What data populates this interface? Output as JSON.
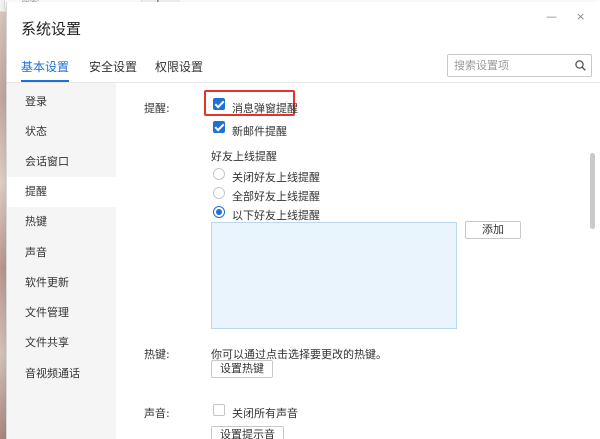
{
  "background": {
    "search_placeholder": "搜索",
    "add_symbol": "+"
  },
  "dialog": {
    "title": "系统设置",
    "minimize": "—",
    "close": "×"
  },
  "tabs": [
    {
      "label": "基本设置",
      "active": true
    },
    {
      "label": "安全设置",
      "active": false
    },
    {
      "label": "权限设置",
      "active": false
    }
  ],
  "search": {
    "placeholder": "搜索设置项",
    "value": ""
  },
  "sidebar": {
    "items": [
      {
        "label": "登录",
        "active": false
      },
      {
        "label": "状态",
        "active": false
      },
      {
        "label": "会话窗口",
        "active": false
      },
      {
        "label": "提醒",
        "active": true
      },
      {
        "label": "热键",
        "active": false
      },
      {
        "label": "声音",
        "active": false
      },
      {
        "label": "软件更新",
        "active": false
      },
      {
        "label": "文件管理",
        "active": false
      },
      {
        "label": "文件共享",
        "active": false
      },
      {
        "label": "音视频通话",
        "active": false
      }
    ]
  },
  "reminder": {
    "section_label": "提醒:",
    "popup_checkbox": {
      "label": "消息弹窗提醒",
      "checked": true
    },
    "mail_checkbox": {
      "label": "新邮件提醒",
      "checked": true
    },
    "friend_online_title": "好友上线提醒",
    "friend_options": [
      {
        "label": "关闭好友上线提醒",
        "selected": false
      },
      {
        "label": "全部好友上线提醒",
        "selected": false
      },
      {
        "label": "以下好友上线提醒",
        "selected": true
      }
    ],
    "add_button": "添加"
  },
  "hotkey": {
    "section_label": "热键:",
    "description": "你可以通过点击选择要更改的热键。",
    "set_button": "设置热键"
  },
  "sound": {
    "section_label": "声音:",
    "mute_checkbox": {
      "label": "关闭所有声音",
      "checked": false
    },
    "set_button": "设置提示音"
  },
  "colors": {
    "accent": "#1f6fd6",
    "highlight": "#e2332c",
    "list_bg": "#eaf4fc"
  }
}
